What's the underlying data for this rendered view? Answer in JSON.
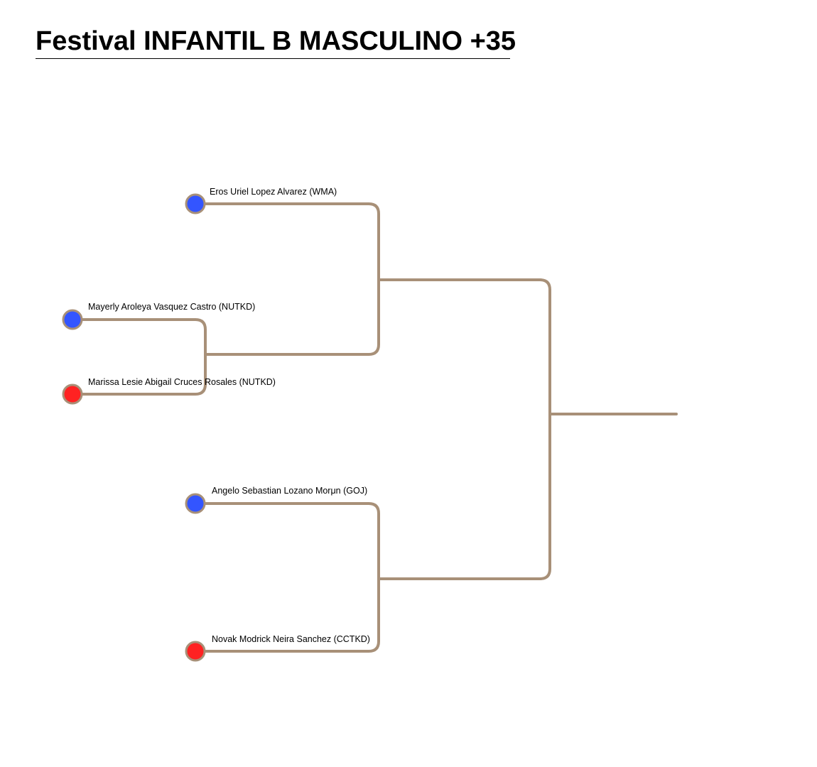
{
  "title": "Festival INFANTIL B MASCULINO +35",
  "colors": {
    "line": "#a89078",
    "blue_corner": "#3355ff",
    "red_corner": "#ff2222",
    "dot_border": "#a89078"
  },
  "competitors": [
    {
      "id": "c1",
      "name": "Eros Uriel Lopez Alvarez (WMA)",
      "corner": "blue"
    },
    {
      "id": "c2",
      "name": "Mayerly Aroleya Vasquez Castro (NUTKD)",
      "corner": "blue"
    },
    {
      "id": "c3",
      "name": "Marissa Lesie Abigail Cruces Rosales (NUTKD)",
      "corner": "red"
    },
    {
      "id": "c4",
      "name": "Angelo Sebastian Lozano Morμn (GOJ)",
      "corner": "blue"
    },
    {
      "id": "c5",
      "name": "Novak Modrick Neira Sanchez (CCTKD)",
      "corner": "red"
    }
  ]
}
